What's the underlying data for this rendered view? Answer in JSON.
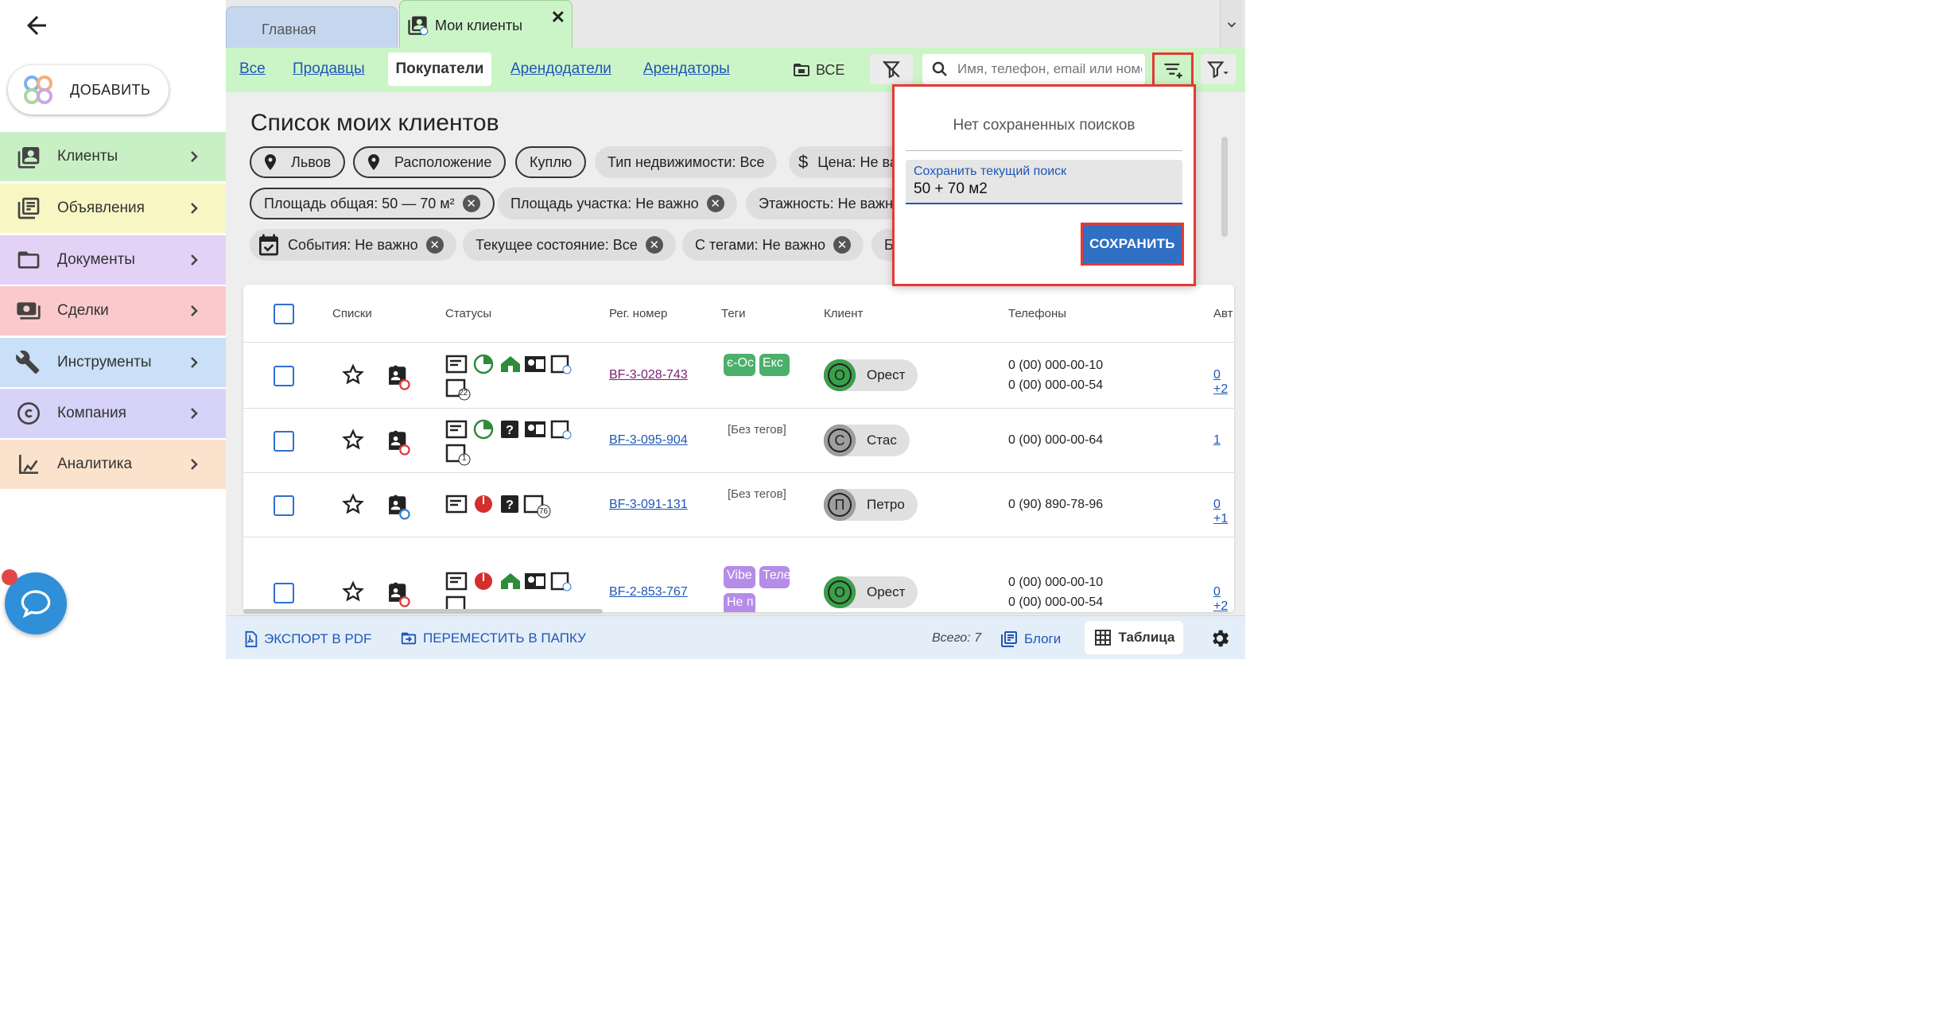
{
  "sidebar": {
    "add_label": "ДОБАВИТЬ",
    "items": [
      {
        "label": "Клиенты",
        "icon": "contacts-icon",
        "bg": "#c9f0c4"
      },
      {
        "label": "Объявления",
        "icon": "listings-icon",
        "bg": "#f8f7c4"
      },
      {
        "label": "Документы",
        "icon": "folder-icon",
        "bg": "#e3d2f6"
      },
      {
        "label": "Сделки",
        "icon": "deals-icon",
        "bg": "#f9c9cb"
      },
      {
        "label": "Инструменты",
        "icon": "tools-icon",
        "bg": "#c9e0f8"
      },
      {
        "label": "Компания",
        "icon": "copyright-icon",
        "bg": "#d6d2f8"
      },
      {
        "label": "Аналитика",
        "icon": "analytics-icon",
        "bg": "#fbe2cd"
      }
    ]
  },
  "tabs": {
    "home": "Главная",
    "clients": "Мои клиенты"
  },
  "filter_tabs": {
    "all": "Все",
    "sellers": "Продавцы",
    "buyers": "Покупатели",
    "landlords": "Арендодатели",
    "tenants": "Арендаторы",
    "folder_all": "ВСЕ"
  },
  "search": {
    "placeholder": "Имя, телефон, email или номер"
  },
  "page_title": "Список моих клиентов",
  "chips": {
    "row1": [
      "Львов",
      "Расположение",
      "Куплю",
      "Тип недвижимости: Все",
      "Цена: Не важно"
    ],
    "row2": [
      "Площадь общая: 50 — 70 м²",
      "Площадь участка: Не важно",
      "Этажность: Не важно"
    ],
    "row3": [
      "События: Не важно",
      "Текущее состояние: Все",
      "С тегами: Не важно",
      "Б"
    ]
  },
  "table": {
    "headers": {
      "lists": "Списки",
      "statuses": "Статусы",
      "reg": "Рег. номер",
      "tags": "Теги",
      "client": "Клиент",
      "phones": "Телефоны",
      "last": "Авт"
    },
    "rows": [
      {
        "reg": "BF-3-028-743",
        "tags": [
          "є-Ос",
          "Екс"
        ],
        "client": "Орест",
        "initial": "О",
        "phones": [
          "0 (00) 000-00-10",
          "0 (00) 000-00-54"
        ],
        "last": "0 +2",
        "badge": "22"
      },
      {
        "reg": "BF-3-095-904",
        "tags_text": "[Без тегов]",
        "client": "Стас",
        "initial": "С",
        "phones": [
          "0 (00) 000-00-64"
        ],
        "last": "1",
        "badge": "1"
      },
      {
        "reg": "BF-3-091-131",
        "tags_text": "[Без тегов]",
        "client": "Петро",
        "initial": "П",
        "phones": [
          "0 (90) 890-78-96"
        ],
        "last": "0 +1",
        "badge": "76"
      },
      {
        "reg": "BF-2-853-767",
        "tags": [
          "Vibe",
          "Теле",
          "Не п"
        ],
        "client": "Орест",
        "initial": "О",
        "phones": [
          "0 (00) 000-00-10",
          "0 (00) 000-00-54"
        ],
        "last": "0 +2"
      }
    ]
  },
  "popover": {
    "empty": "Нет сохраненных поисков",
    "field_label": "Сохранить текущий поиск",
    "field_value": "50 + 70 м2",
    "save": "СОХРАНИТЬ"
  },
  "bottom": {
    "export": "ЭКСПОРТ В PDF",
    "move": "ПЕРЕМЕСТИТЬ В ПАПКУ",
    "total": "Всего: 7",
    "blogs": "Блоги",
    "table": "Таблица"
  },
  "colors": {
    "accent_blue": "#1d57b8",
    "green_active": "#ccf5c7",
    "highlight_red": "#e53935",
    "save_button": "#2f6fc4"
  }
}
